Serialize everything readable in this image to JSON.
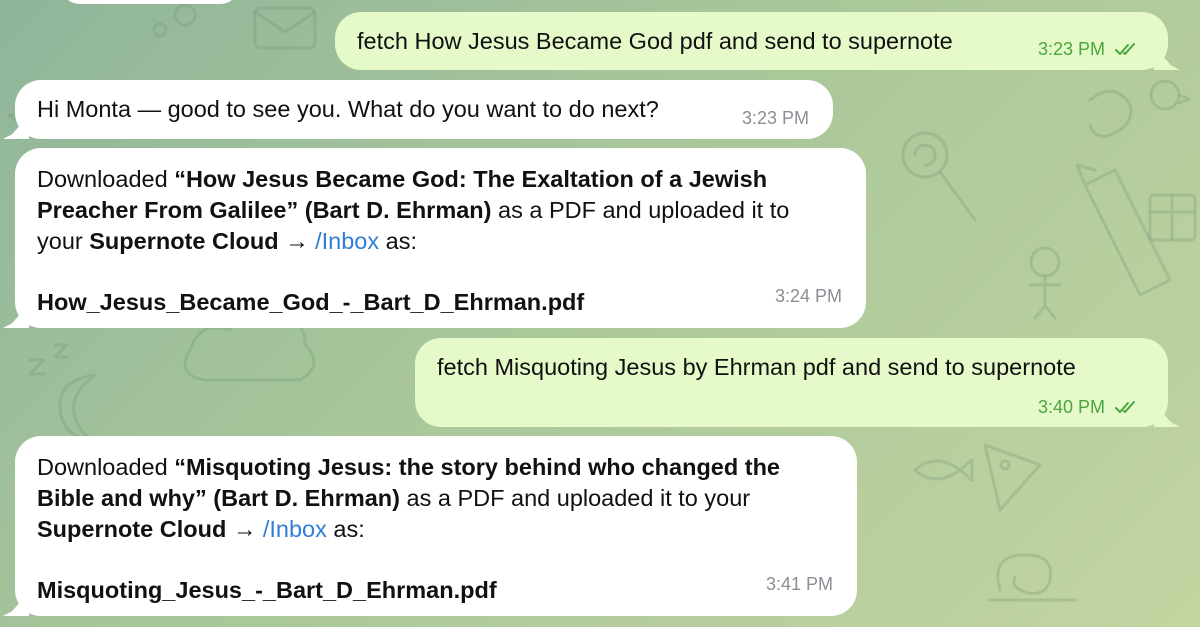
{
  "messages": [
    {
      "id": "m1",
      "direction": "outgoing",
      "text": "fetch How Jesus Became God pdf and send to supernote",
      "time": "3:23 PM",
      "read_status": "read"
    },
    {
      "id": "m2",
      "direction": "incoming",
      "text": "Hi Monta — good to see you. What do you want to do next?",
      "time": "3:23 PM"
    },
    {
      "id": "m3",
      "direction": "incoming",
      "prefix": "Downloaded ",
      "title": "“How Jesus Became God: The Exaltation of a Jewish Preacher From Galilee” (Bart D. Ehrman)",
      "title_line1": "“How Jesus Became God: The Exaltation of a Jewish",
      "title_line2": "Preacher From Galilee” (Bart D. Ehrman)",
      "middle": " as a PDF and uploaded it to",
      "middle2": "your ",
      "cloud": "Supernote Cloud",
      "arrow": " → ",
      "folder": "/Inbox",
      "suffix": " as:",
      "filename": "How_Jesus_Became_God_-_Bart_D_Ehrman.pdf",
      "time": "3:24 PM"
    },
    {
      "id": "m4",
      "direction": "outgoing",
      "text": "fetch Misquoting Jesus by Ehrman pdf and send to supernote",
      "time": "3:40 PM",
      "read_status": "read"
    },
    {
      "id": "m5",
      "direction": "incoming",
      "prefix": "Downloaded ",
      "title_line1": "“Misquoting Jesus: the story behind who changed the",
      "title_line2": "Bible and why” (Bart D. Ehrman)",
      "middle": " as a PDF and uploaded it to your",
      "cloud": "Supernote Cloud",
      "arrow": " → ",
      "folder": "/Inbox",
      "suffix": " as:",
      "filename": "Misquoting_Jesus_-_Bart_D_Ehrman.pdf",
      "time": "3:41 PM"
    }
  ],
  "colors": {
    "outgoing_bubble": "#e6f9c9",
    "incoming_bubble": "#ffffff",
    "link": "#2f7ed8",
    "outgoing_time": "#4aa63f"
  },
  "icons": {
    "read_receipt": "double-check-icon",
    "wallpaper": "doodle-pattern"
  }
}
